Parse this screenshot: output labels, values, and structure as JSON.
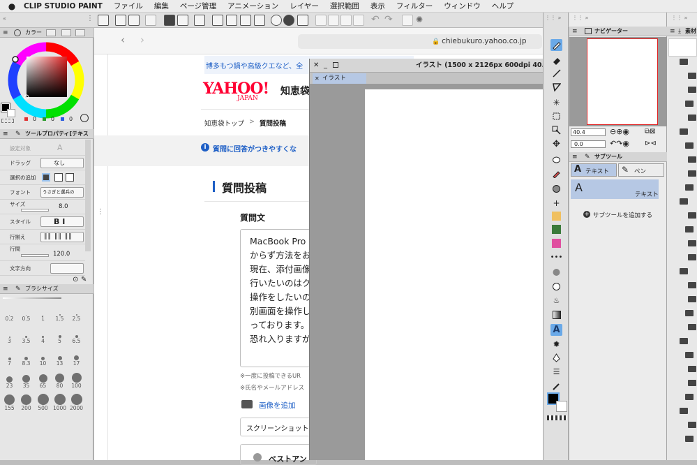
{
  "menubar": {
    "apple": "",
    "app": "CLIP STUDIO PAINT",
    "items": [
      "ファイル",
      "編集",
      "ページ管理",
      "アニメーション",
      "レイヤー",
      "選択範囲",
      "表示",
      "フィルター",
      "ウィンドウ",
      "ヘルプ"
    ]
  },
  "color_panel": {
    "tab": "カラー",
    "rgb": [
      "0",
      "0",
      "0"
    ],
    "colors": {
      "r": "#e03030",
      "g": "#2a9a2a",
      "b": "#2a5ae0"
    }
  },
  "tool_property": {
    "title": "ツールプロパティ[テキス",
    "rows": [
      {
        "label": "設定対象",
        "value": ""
      },
      {
        "label": "ドラッグ",
        "value": "なし"
      },
      {
        "label": "選択の追加",
        "value": ""
      },
      {
        "label": "フォント",
        "value": "うさぎと選兵の"
      },
      {
        "label": "サイズ",
        "value": "8.0"
      },
      {
        "label": "スタイル",
        "value": "B I"
      },
      {
        "label": "行揃え",
        "value": ""
      },
      {
        "label": "行間",
        "value": "120.0"
      },
      {
        "label": "文字方向",
        "value": ""
      }
    ]
  },
  "brush_size": {
    "title": "ブラシサイズ",
    "sizes": [
      "0.2",
      "0.5",
      "1",
      "1.5",
      "2.5",
      "3",
      "3.5",
      "4",
      "5",
      "6.5",
      "7",
      "8.3",
      "10",
      "13",
      "17",
      "23",
      "35",
      "65",
      "80",
      "100",
      "155",
      "200",
      "500",
      "1000",
      "2000"
    ]
  },
  "browser": {
    "url": "chiebukuro.yahoo.co.jp",
    "banner": "博多もつ鍋や高級クエなど、全",
    "logo": "YAHOO!",
    "logo_sub": "JAPAN",
    "site_name": "知恵袋",
    "breadcrumb": [
      "知恵袋トップ",
      ">",
      "質問投稿"
    ],
    "info": "質問に回答がつきやすくな",
    "heading": "質問投稿",
    "label": "質問文",
    "question_lines": [
      "MacBook Pro",
      "からず方法をお",
      "現在、添付画像",
      "行いたいのはク",
      "操作をしたいの",
      "別画面を操作し",
      "っております。",
      "恐れ入りますが"
    ],
    "notes": [
      "※一度に投稿できるUR",
      "※氏名やメールアドレス"
    ],
    "add_image": "画像を追加",
    "screenshot": "スクリーンショット",
    "bottom": "ベストアン"
  },
  "illustration": {
    "title": "イラスト (1500 x 2126px 600dpi 40.",
    "tab": "イラスト"
  },
  "navigator": {
    "title": "ナビゲーター",
    "zoom": "40.4",
    "angle": "0.0"
  },
  "subtool": {
    "title": "サブツール",
    "tabs": [
      "テキスト",
      "ペン"
    ],
    "item": "テキスト",
    "add": "サブツールを追加する"
  },
  "material": {
    "title": "素材"
  }
}
